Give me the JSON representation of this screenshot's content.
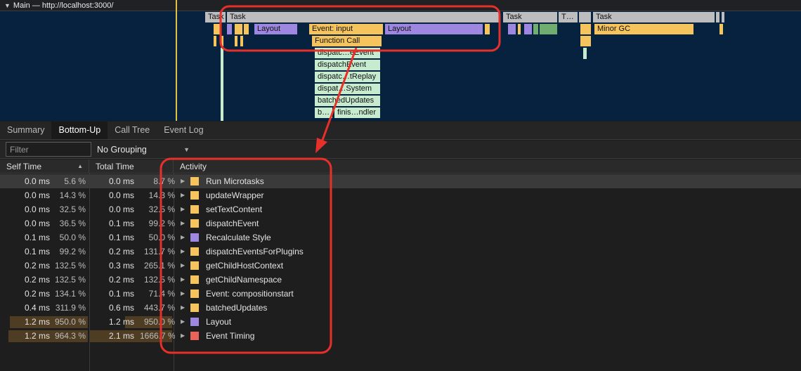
{
  "track": {
    "title": "Main — http://localhost:3000/"
  },
  "flame": {
    "labels": {
      "task_a": "Task",
      "task_b": "Task",
      "task_c": "Task",
      "task_d": "T…",
      "task_e": "Task",
      "layout_a": "Layout",
      "event_input": "Event: input",
      "layout_b": "Layout",
      "minor_gc": "Minor GC",
      "function_call": "Function Call",
      "s1": "dispatc…eEvent",
      "s2": "dispatchEvent",
      "s3": "dispatc…tReplay",
      "s4": "dispat…System",
      "s5": "batchedUpdates",
      "s6a": "b…",
      "s6b": "finis…ndler"
    }
  },
  "tabs": [
    "Summary",
    "Bottom-Up",
    "Call Tree",
    "Event Log"
  ],
  "active_tab": "Bottom-Up",
  "filter": {
    "placeholder": "Filter",
    "value": ""
  },
  "grouping": {
    "selected": "No Grouping"
  },
  "columns": {
    "self": "Self Time",
    "total": "Total Time",
    "activity": "Activity"
  },
  "colors": {
    "scripting": "#f5c45c",
    "rendering": "#9e87e0",
    "timing": "#e8635a",
    "annotation": "#e8302a"
  },
  "rows": [
    {
      "self_ms": "0.0 ms",
      "self_pct": "5.6 %",
      "self_frac": 0.0,
      "total_ms": "0.0 ms",
      "total_pct": "8.7 %",
      "total_frac": 0.0,
      "activity": "Run Microtasks",
      "category": "scripting"
    },
    {
      "self_ms": "0.0 ms",
      "self_pct": "14.3 %",
      "self_frac": 0.0,
      "total_ms": "0.0 ms",
      "total_pct": "14.3 %",
      "total_frac": 0.0,
      "activity": "updateWrapper",
      "category": "scripting"
    },
    {
      "self_ms": "0.0 ms",
      "self_pct": "32.5 %",
      "self_frac": 0.0,
      "total_ms": "0.0 ms",
      "total_pct": "32.5 %",
      "total_frac": 0.0,
      "activity": "setTextContent",
      "category": "scripting"
    },
    {
      "self_ms": "0.0 ms",
      "self_pct": "36.5 %",
      "self_frac": 0.0,
      "total_ms": "0.1 ms",
      "total_pct": "99.2 %",
      "total_frac": 0.0,
      "activity": "dispatchEvent",
      "category": "scripting"
    },
    {
      "self_ms": "0.1 ms",
      "self_pct": "50.0 %",
      "self_frac": 0.0,
      "total_ms": "0.1 ms",
      "total_pct": "50.0 %",
      "total_frac": 0.0,
      "activity": "Recalculate Style",
      "category": "rendering"
    },
    {
      "self_ms": "0.1 ms",
      "self_pct": "99.2 %",
      "self_frac": 0.0,
      "total_ms": "0.2 ms",
      "total_pct": "131.7 %",
      "total_frac": 0.0,
      "activity": "dispatchEventsForPlugins",
      "category": "scripting"
    },
    {
      "self_ms": "0.2 ms",
      "self_pct": "132.5 %",
      "self_frac": 0.0,
      "total_ms": "0.3 ms",
      "total_pct": "265.1 %",
      "total_frac": 0.0,
      "activity": "getChildHostContext",
      "category": "scripting"
    },
    {
      "self_ms": "0.2 ms",
      "self_pct": "132.5 %",
      "self_frac": 0.0,
      "total_ms": "0.2 ms",
      "total_pct": "132.5 %",
      "total_frac": 0.0,
      "activity": "getChildNamespace",
      "category": "scripting"
    },
    {
      "self_ms": "0.2 ms",
      "self_pct": "134.1 %",
      "self_frac": 0.0,
      "total_ms": "0.1 ms",
      "total_pct": "71.4 %",
      "total_frac": 0.0,
      "activity": "Event: compositionstart",
      "category": "scripting"
    },
    {
      "self_ms": "0.4 ms",
      "self_pct": "311.9 %",
      "self_frac": 0.0,
      "total_ms": "0.6 ms",
      "total_pct": "443.7 %",
      "total_frac": 0.0,
      "activity": "batchedUpdates",
      "category": "scripting"
    },
    {
      "self_ms": "1.2 ms",
      "self_pct": "950.0 %",
      "self_frac": 0.95,
      "total_ms": "1.2 ms",
      "total_pct": "950.0 %",
      "total_frac": 0.57,
      "activity": "Layout",
      "category": "rendering"
    },
    {
      "self_ms": "1.2 ms",
      "self_pct": "964.3 %",
      "self_frac": 0.97,
      "total_ms": "2.1 ms",
      "total_pct": "1666.7 %",
      "total_frac": 1.0,
      "activity": "Event Timing",
      "category": "timing"
    }
  ]
}
